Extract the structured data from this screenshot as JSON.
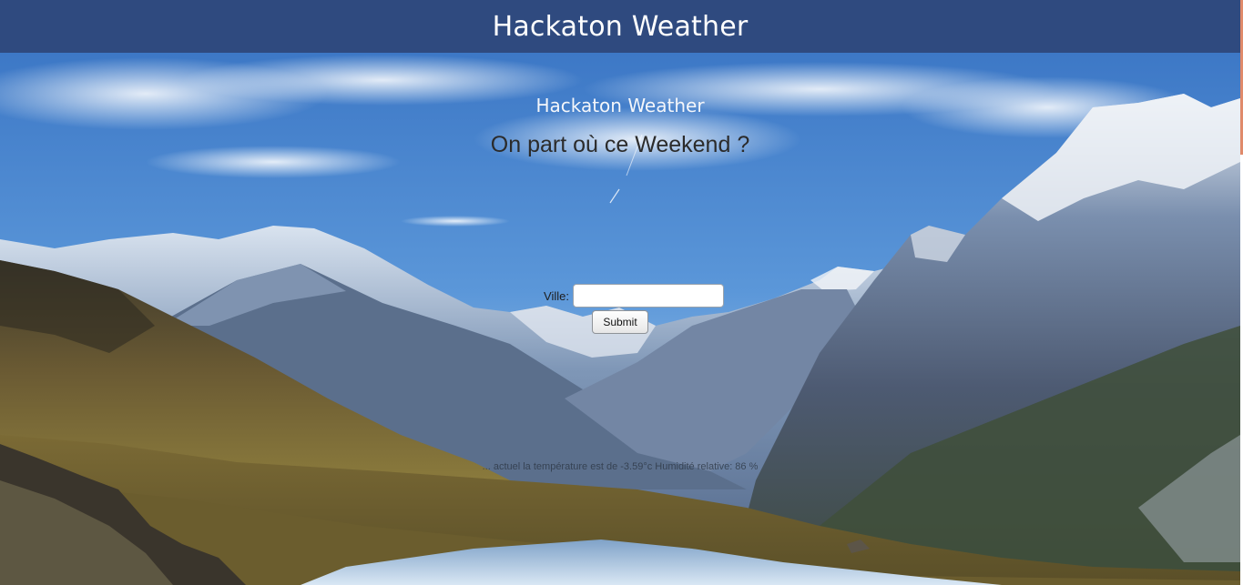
{
  "header": {
    "title": "Hackaton Weather"
  },
  "main": {
    "subtitle": "Hackaton Weather",
    "question": "On part où ce Weekend ?",
    "form": {
      "city_label": "Ville:",
      "city_value": "",
      "city_placeholder": "",
      "submit_label": "Submit"
    },
    "result_text": "... actuel la température est de -3.59°c Humidité relative: 86 %"
  },
  "colors": {
    "header_bg": "#2f4a7f",
    "header_text": "#ffffff",
    "scroll_accent": "#e08a6a"
  }
}
